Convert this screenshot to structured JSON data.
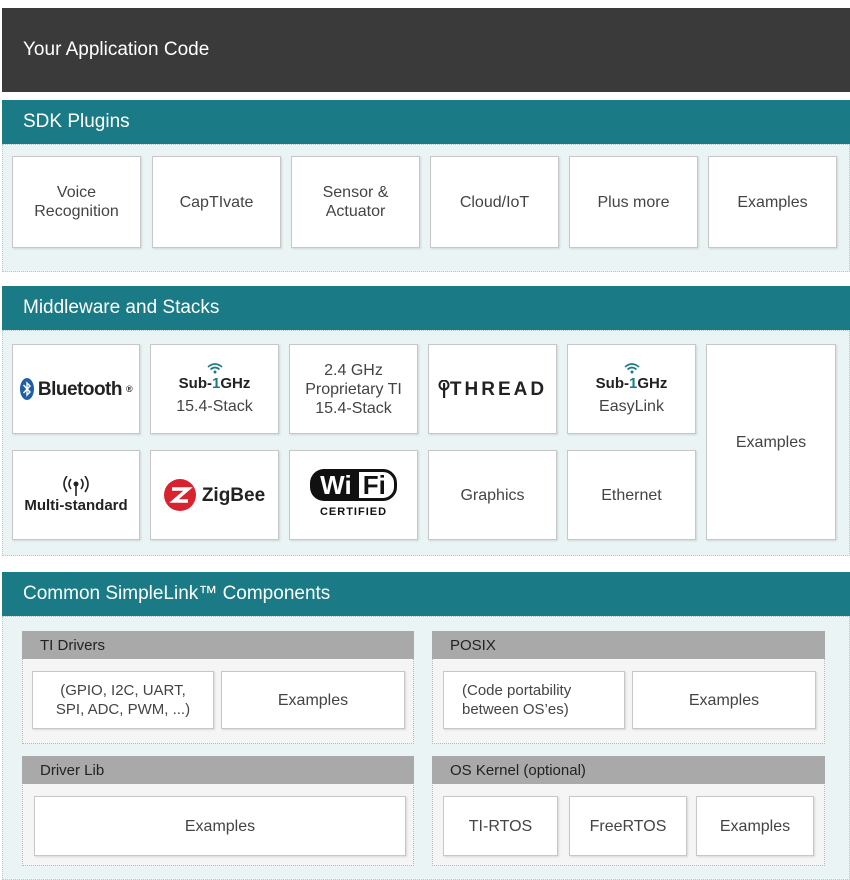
{
  "app_bar": {
    "label": "Your Application Code"
  },
  "sdk_plugins": {
    "title": "SDK Plugins",
    "tiles": [
      "Voice\nRecognition",
      "CapTIvate",
      "Sensor &\nActuator",
      "Cloud/IoT",
      "Plus more",
      "Examples"
    ]
  },
  "middleware": {
    "title": "Middleware and Stacks",
    "bluetooth": "Bluetooth",
    "sub1_a": {
      "sub": "Sub-",
      "one": "1",
      "ghz": "GHz",
      "caption": "15.4-Stack"
    },
    "proprietary": "2.4 GHz\nProprietary TI\n15.4-Stack",
    "thread": "THREAD",
    "sub1_b": {
      "sub": "Sub-",
      "one": "1",
      "ghz": "GHz",
      "caption": "EasyLink"
    },
    "examples": "Examples",
    "multi_standard": "Multi-standard",
    "zigbee": "ZigBee",
    "wifi": {
      "wi": "Wi",
      "fi": "Fi",
      "certified": "CERTIFIED"
    },
    "graphics": "Graphics",
    "ethernet": "Ethernet"
  },
  "common": {
    "title": "Common SimpleLink™ Components",
    "ti_drivers": {
      "title": "TI Drivers",
      "desc": "(GPIO, I2C, UART,\nSPI, ADC, PWM, ...)",
      "examples": "Examples"
    },
    "posix": {
      "title": "POSIX",
      "desc": "(Code portability\nbetween OS’es)",
      "examples": "Examples"
    },
    "driver_lib": {
      "title": "Driver Lib",
      "examples": "Examples"
    },
    "os_kernel": {
      "title": "OS Kernel (optional)",
      "tirtos": "TI-RTOS",
      "freertos": "FreeRTOS",
      "examples": "Examples"
    }
  },
  "colors": {
    "dark_bar": "#3a3a3a",
    "teal": "#1a7a86",
    "gray_bar": "#a9a9a9",
    "panel": "#eaf4f5"
  }
}
